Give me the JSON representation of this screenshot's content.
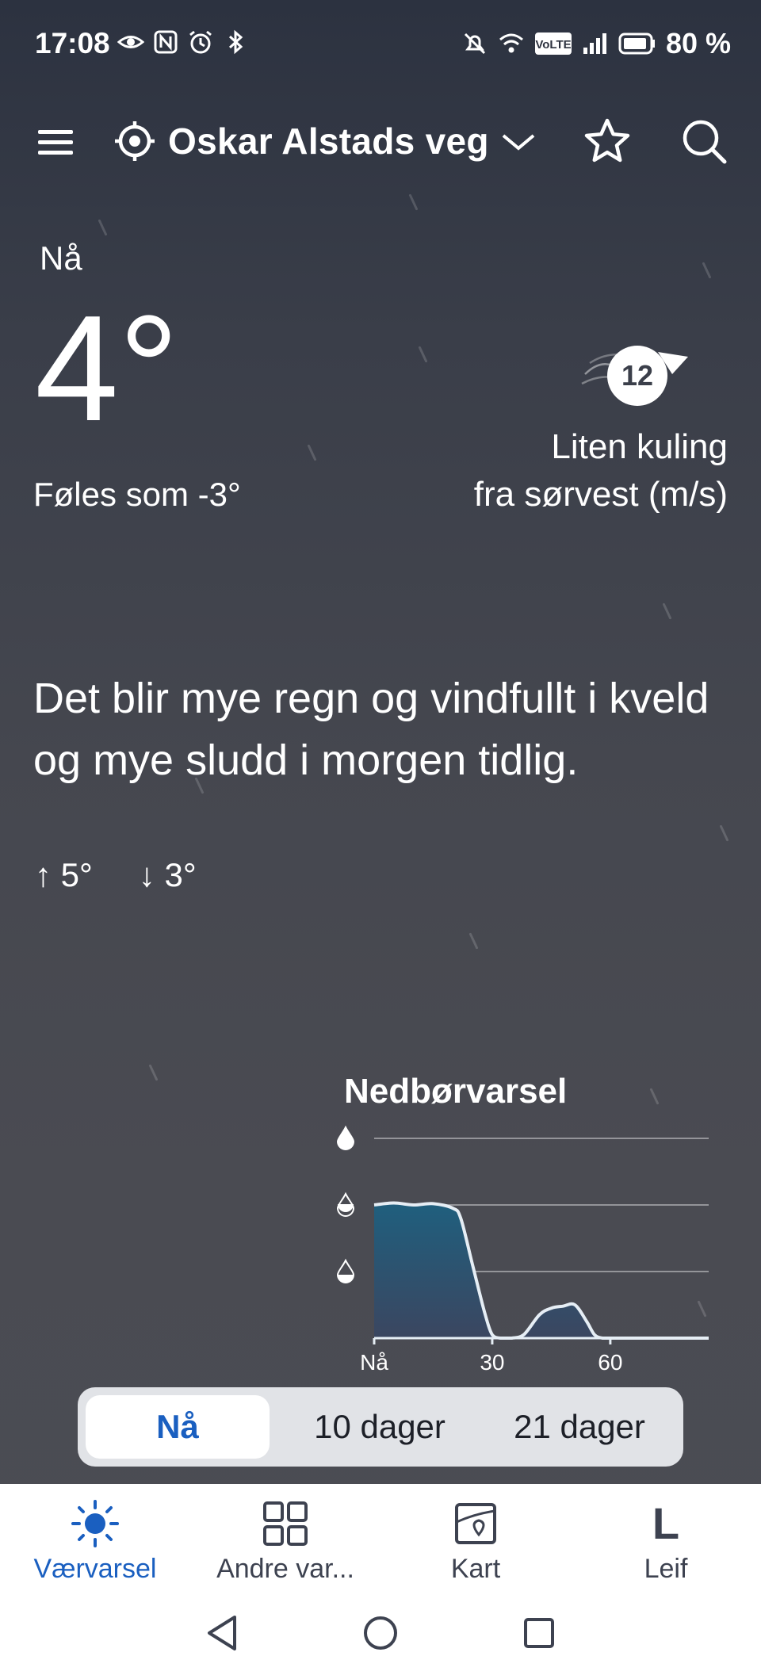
{
  "status_bar": {
    "time": "17:08",
    "battery": "80 %",
    "left_icons": [
      "eye-icon",
      "nfc-icon",
      "alarm-icon",
      "bluetooth-icon"
    ],
    "right_icons": [
      "mute-icon",
      "wifi-icon",
      "volte-icon",
      "signal-icon",
      "battery-icon"
    ]
  },
  "header": {
    "location": "Oskar Alstads veg"
  },
  "current": {
    "label": "Nå",
    "temperature": "4°",
    "feels_like": "Føles som -3°",
    "wind_speed": "12",
    "wind_line1": "Liten kuling",
    "wind_line2": "fra sørvest (m/s)",
    "summary": "Det blir mye regn og vindfullt i kveld og mye sludd i morgen tidlig.",
    "high": "5°",
    "low": "3°"
  },
  "precip": {
    "title": "Nedbørvarsel",
    "xticks": [
      "Nå",
      "30",
      "60"
    ]
  },
  "chart_data": {
    "type": "area",
    "title": "Nedbørvarsel",
    "x": [
      0,
      5,
      10,
      15,
      20,
      22,
      25,
      28,
      30,
      32,
      35,
      38,
      42,
      45,
      48,
      51,
      54,
      56,
      58,
      60,
      70,
      85
    ],
    "values": [
      2.0,
      2.03,
      2.0,
      2.02,
      1.95,
      1.8,
      1.1,
      0.4,
      0.05,
      0.0,
      0.0,
      0.05,
      0.35,
      0.45,
      0.48,
      0.5,
      0.25,
      0.05,
      0.0,
      0.0,
      0.0,
      0.0
    ],
    "xticks": [
      "Nå",
      "30",
      "60"
    ],
    "ylim": [
      0,
      3
    ],
    "grid": true,
    "colors": {
      "fill_top": "#1f5f7e",
      "fill_bottom": "#3b4660",
      "line": "#e6eef5"
    }
  },
  "segments": {
    "tabs": [
      "Nå",
      "10 dager",
      "21 dager"
    ],
    "active": "Nå"
  },
  "bottom_nav": [
    {
      "label": "Værvarsel",
      "icon": "sun-icon",
      "active": true
    },
    {
      "label": "Andre var...",
      "icon": "grid-icon",
      "active": false
    },
    {
      "label": "Kart",
      "icon": "map-icon",
      "active": false
    },
    {
      "label": "Leif",
      "icon": "leif-icon",
      "active": false
    }
  ],
  "leif_letter": "L",
  "colors": {
    "accent": "#1a5fc0",
    "background": "#3f424b"
  }
}
